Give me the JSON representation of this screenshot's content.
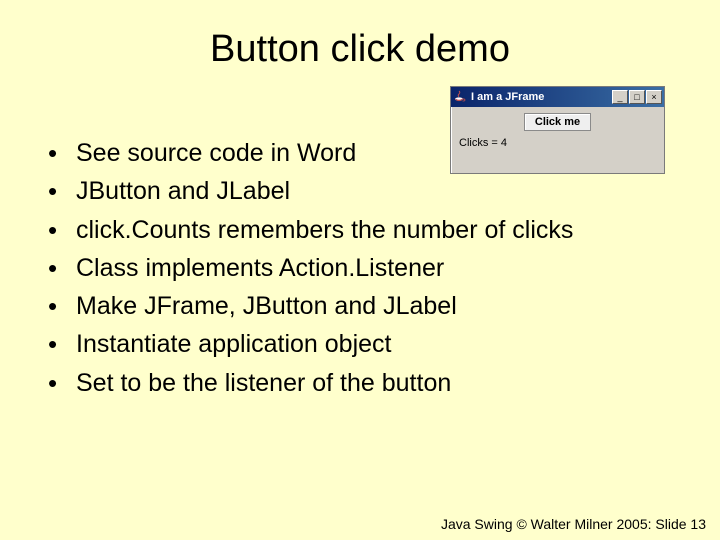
{
  "title": "Button click demo",
  "bullets": [
    "See source code in Word",
    "JButton and JLabel",
    "click.Counts remembers the number of clicks",
    "Class implements Action.Listener",
    "Make JFrame, JButton and JLabel",
    "Instantiate application object",
    "Set to be the listener of the button"
  ],
  "footer": "Java Swing © Walter Milner 2005: Slide 13",
  "swing": {
    "window_title": "I am a JFrame",
    "button_label": "Click me",
    "counter_text": "Clicks = 4",
    "controls": {
      "min": "_",
      "max": "□",
      "close": "×"
    }
  },
  "chart_data": {
    "type": "table",
    "note": "Presentation slide — no chart data",
    "slide_number": 13
  }
}
